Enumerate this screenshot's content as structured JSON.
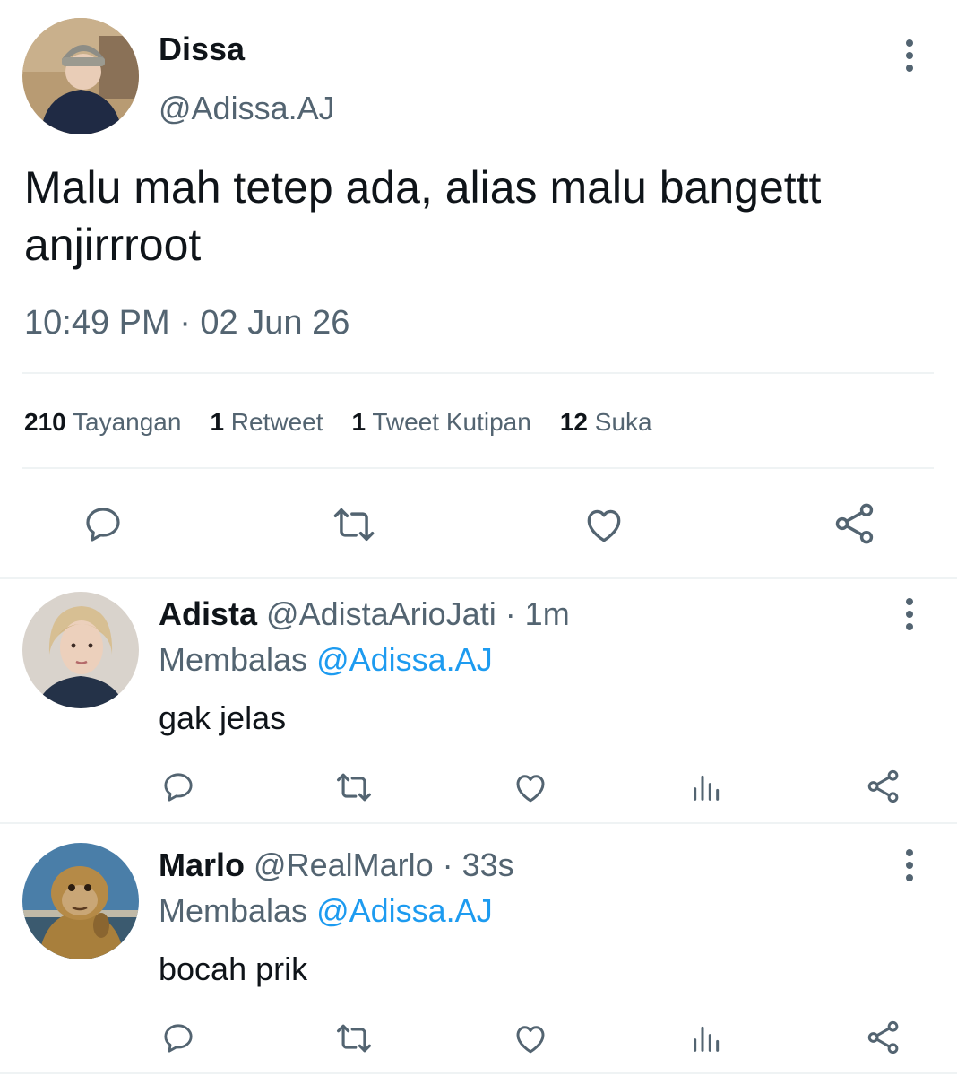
{
  "main_tweet": {
    "author_name": "Dissa",
    "author_handle": "@Adissa.AJ",
    "text_line1": "Malu mah tetep ada, alias malu bangettt",
    "text_line2": "anjirrroot",
    "timestamp": "10:49 PM · 02 Jun 26",
    "stats": [
      {
        "count": "210",
        "label": "Tayangan"
      },
      {
        "count": "1",
        "label": "Retweet"
      },
      {
        "count": "1",
        "label": "Tweet Kutipan"
      },
      {
        "count": "12",
        "label": "Suka"
      }
    ]
  },
  "replies": [
    {
      "name": "Adista",
      "handle_time": "@AdistaArioJati · 1m",
      "reply_prefix": "Membalas",
      "reply_to": "@Adissa.AJ",
      "text": "gak jelas"
    },
    {
      "name": "Marlo",
      "handle_time": "@RealMarlo · 33s",
      "reply_prefix": "Membalas",
      "reply_to": "@Adissa.AJ",
      "text": "bocah prik"
    }
  ],
  "icons": {
    "reply": "reply-icon",
    "retweet": "retweet-icon",
    "like": "heart-icon",
    "views": "views-icon",
    "share": "share-icon",
    "more": "more-vertical-icon"
  },
  "colors": {
    "text": "#0f1419",
    "muted": "#536471",
    "link": "#1d9bf0",
    "divider": "#eff3f4"
  }
}
